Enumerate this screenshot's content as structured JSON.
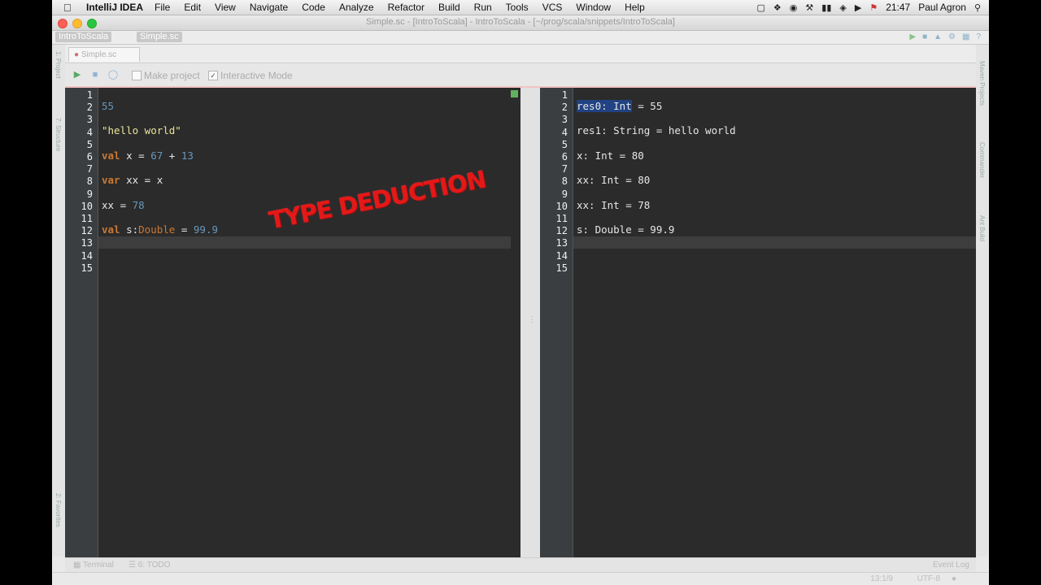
{
  "menubar": {
    "app_name": "IntelliJ IDEA",
    "items": [
      "File",
      "Edit",
      "View",
      "Navigate",
      "Code",
      "Analyze",
      "Refactor",
      "Build",
      "Run",
      "Tools",
      "VCS",
      "Window",
      "Help"
    ],
    "clock": "21:47",
    "user": "Paul Agron"
  },
  "window": {
    "title": "Simple.sc - [IntroToScala] - IntroToScala - [~/prog/scala/snippets/IntroToScala]"
  },
  "navbar": {
    "crumb_project": "IntroToScala",
    "crumb_file": "Simple.sc"
  },
  "tab": {
    "label": "Simple.sc"
  },
  "worksheet_toolbar": {
    "make_project_label": "Make project",
    "interactive_mode_label": "Interactive Mode",
    "make_project_checked": false,
    "interactive_mode_checked": true
  },
  "left_strip": {
    "project_label": "1: Project",
    "structure_label": "7: Structure",
    "favorites_label": "2: Favorites"
  },
  "right_strip": {
    "maven_label": "Maven Projects",
    "commander_label": "Commander",
    "ant_label": "Ant Build"
  },
  "editor": {
    "line_numbers": [
      "1",
      "2",
      "3",
      "4",
      "5",
      "6",
      "7",
      "8",
      "9",
      "10",
      "11",
      "12",
      "13",
      "14",
      "15"
    ],
    "current_line": 13,
    "lines": {
      "l2": {
        "num": "55"
      },
      "l4": {
        "str": "\"hello world\""
      },
      "l6": {
        "kw": "val",
        "name": " x = ",
        "num1": "67",
        "op": " + ",
        "num2": "13"
      },
      "l8": {
        "kw": "var",
        "rest": " xx = x"
      },
      "l10": {
        "name": "xx = ",
        "num": "78"
      },
      "l12": {
        "kw": "val",
        "name": " s:",
        "type": "Double",
        "op": " = ",
        "num": "99.9"
      }
    }
  },
  "output": {
    "line_numbers": [
      "1",
      "2",
      "3",
      "4",
      "5",
      "6",
      "7",
      "8",
      "9",
      "10",
      "11",
      "12",
      "13",
      "14",
      "15"
    ],
    "l2": {
      "selected": "res0: Int",
      "rest": " = 55"
    },
    "l4": "res1: String = hello world",
    "l6": "x: Int = 80",
    "l8": "xx: Int = 80",
    "l10": "xx: Int = 78",
    "l12": "s: Double = 99.9"
  },
  "overlay_text": "TYPE DEDUCTION",
  "tool_windows": {
    "terminal": "Terminal",
    "todo": "6: TODO",
    "event_log": "Event Log"
  },
  "status": {
    "position": "13:1/9",
    "encoding": "UTF-8"
  },
  "colors": {
    "keyword": "#cc7832",
    "number": "#6897bb",
    "string": "#e8e39a",
    "editor_bg": "#2b2b2b",
    "overlay": "#e51818"
  }
}
